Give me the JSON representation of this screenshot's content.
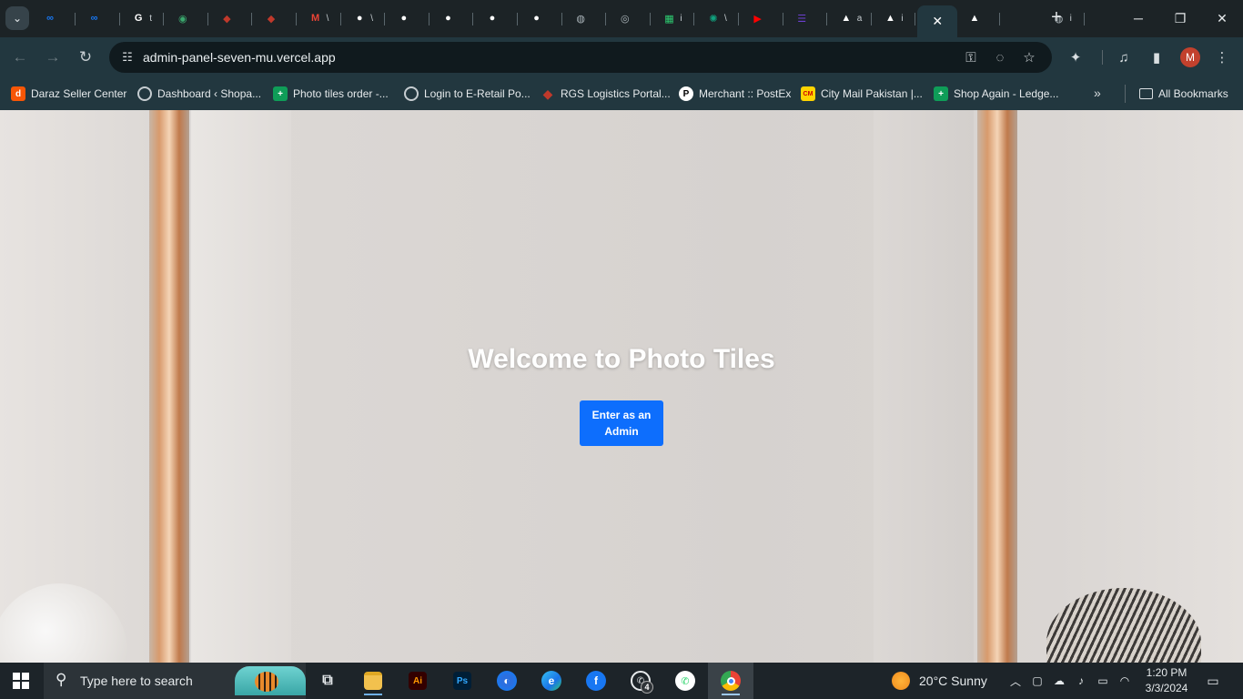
{
  "browser": {
    "tabs": [
      {
        "icon": "meta-icon",
        "color": "#1877f2",
        "glyph": "∞"
      },
      {
        "icon": "meta-icon",
        "color": "#1877f2",
        "glyph": "∞"
      },
      {
        "icon": "google-icon",
        "color": "#ffffff",
        "glyph": "G"
      },
      {
        "icon": "earth-icon",
        "color": "#3aa76d",
        "glyph": "◉"
      },
      {
        "icon": "rgs-icon",
        "color": "#c0392b",
        "glyph": "◆"
      },
      {
        "icon": "rgs-icon",
        "color": "#c0392b",
        "glyph": "◆"
      },
      {
        "icon": "gmail-icon",
        "color": "#ea4335",
        "glyph": "M"
      },
      {
        "icon": "github-icon",
        "color": "#ffffff",
        "glyph": "●"
      },
      {
        "icon": "github-icon",
        "color": "#ffffff",
        "glyph": "●"
      },
      {
        "icon": "github-icon",
        "color": "#ffffff",
        "glyph": "●"
      },
      {
        "icon": "github-icon",
        "color": "#ffffff",
        "glyph": "●"
      },
      {
        "icon": "github-icon",
        "color": "#ffffff",
        "glyph": "●"
      },
      {
        "icon": "globe-icon",
        "color": "#aab4b9",
        "glyph": "◍"
      },
      {
        "icon": "chrome-icon",
        "color": "#aab4b9",
        "glyph": "◎"
      },
      {
        "icon": "sheets-icon",
        "color": "#2ecc71",
        "glyph": "▦"
      },
      {
        "icon": "openai-icon",
        "color": "#10a37f",
        "glyph": "✺"
      },
      {
        "icon": "youtube-icon",
        "color": "#ff0000",
        "glyph": "▶"
      },
      {
        "icon": "list-icon",
        "color": "#6c3fd1",
        "glyph": "☰"
      },
      {
        "icon": "vercel-icon",
        "color": "#ffffff",
        "glyph": "▲"
      },
      {
        "icon": "vercel-icon",
        "color": "#ffffff",
        "glyph": "▲"
      },
      {
        "icon": "vercel-icon",
        "color": "#ffffff",
        "glyph": "▲"
      },
      {
        "icon": "globe-icon",
        "color": "#aab4b9",
        "glyph": "◍"
      }
    ],
    "tab_fragments": [
      "t",
      "\\",
      "\\",
      "i",
      "\\",
      "a",
      "i",
      "i"
    ],
    "url": "admin-panel-seven-mu.vercel.app",
    "profile_initial": "M"
  },
  "bookmarks": [
    {
      "label": "Daraz Seller Center",
      "icon": "daraz-icon",
      "color": "#f85606"
    },
    {
      "label": "Dashboard ‹ Shopa...",
      "icon": "globe-icon",
      "color": "#5f6b71"
    },
    {
      "label": "Photo tiles order -...",
      "icon": "sheets-icon",
      "color": "#0f9d58"
    },
    {
      "label": "Login to E-Retail Po...",
      "icon": "globe-icon",
      "color": "#5f6b71"
    },
    {
      "label": "RGS Logistics Portal...",
      "icon": "rgs-icon",
      "color": "#c0392b"
    },
    {
      "label": "Merchant :: PostEx",
      "icon": "postex-icon",
      "color": "#ffffff"
    },
    {
      "label": "City Mail Pakistan |...",
      "icon": "citymail-icon",
      "color": "#ffd400"
    },
    {
      "label": "Shop Again - Ledge...",
      "icon": "sheets-icon",
      "color": "#0f9d58"
    }
  ],
  "bookmarks_all": "All Bookmarks",
  "page": {
    "title": "Welcome to Photo Tiles",
    "button": "Enter as an Admin",
    "accent": "#0d6efd"
  },
  "taskbar": {
    "search_placeholder": "Type here to search",
    "weather": "20°C  Sunny",
    "time": "1:20 PM",
    "date": "3/3/2024",
    "whatsapp_badge": "4"
  }
}
